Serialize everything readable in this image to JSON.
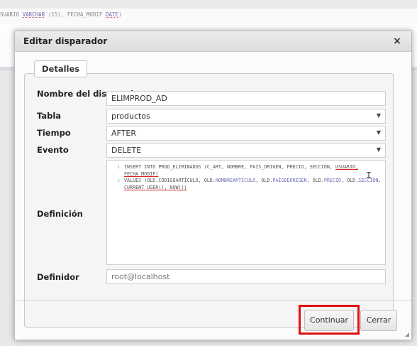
{
  "background": {
    "code_parts": [
      {
        "text": "SUARIO ",
        "kw": false
      },
      {
        "text": "VARCHAR",
        "kw": true
      },
      {
        "text": " (15), FECHA_MODIF ",
        "kw": false
      },
      {
        "text": "DATE",
        "kw": true
      },
      {
        "text": ")",
        "kw": false
      }
    ]
  },
  "dialog": {
    "title": "Editar disparador",
    "close_glyph": "×",
    "section_label": "Detalles",
    "fields": {
      "name_label": "Nombre del disparador",
      "name_value": "ELIMPROD_AD",
      "table_label": "Tabla",
      "table_value": "productos",
      "time_label": "Tiempo",
      "time_value": "AFTER",
      "event_label": "Evento",
      "event_value": "DELETE",
      "definition_label": "Definición",
      "definer_label": "Definidor",
      "definer_value": "root@localhost"
    },
    "definition": {
      "line_numbers": [
        "1",
        "",
        "2",
        ""
      ],
      "line1_parts": [
        {
          "text": "INSERT INTO PROD_ELIMINADOS (C_ART, NOMBRE, PAÍS_ORIGEN, PRECIO, SECCIÓN, ",
          "kw": false,
          "red": false
        },
        {
          "text": "USUARIO, FECHA_MODIF)",
          "kw": false,
          "red": true
        }
      ],
      "line2_parts": [
        {
          "text": "VALUES ",
          "kw": false,
          "red": false
        },
        {
          "text": "(OLD.CÓDIGOARTÍCULO, OLD.",
          "kw": false,
          "red": false
        },
        {
          "text": "NOMBREARTÍCULO",
          "kw": true,
          "red": false
        },
        {
          "text": ", OLD.",
          "kw": false,
          "red": false
        },
        {
          "text": "PAÍSDEORIGEN",
          "kw": true,
          "red": false
        },
        {
          "text": ", OLD.",
          "kw": false,
          "red": false
        },
        {
          "text": "PRECIO",
          "kw": true,
          "red": false
        },
        {
          "text": ", OLD.",
          "kw": false,
          "red": false
        },
        {
          "text": "SECCIÓN",
          "kw": true,
          "red": false
        },
        {
          "text": ", ",
          "kw": false,
          "red": false
        },
        {
          "text": "CURRENT_USER(), NOW())",
          "kw": false,
          "red": true
        }
      ]
    },
    "buttons": {
      "continue_label": "Continuar",
      "close_label": "Cerrar"
    },
    "icons": {
      "dropdown": "chevron-down-icon",
      "text_cursor": "text-cursor-icon",
      "resize": "resize-grip-icon"
    },
    "colors": {
      "highlight_border": "#e01010",
      "keyword": "#6b6bb5"
    }
  }
}
